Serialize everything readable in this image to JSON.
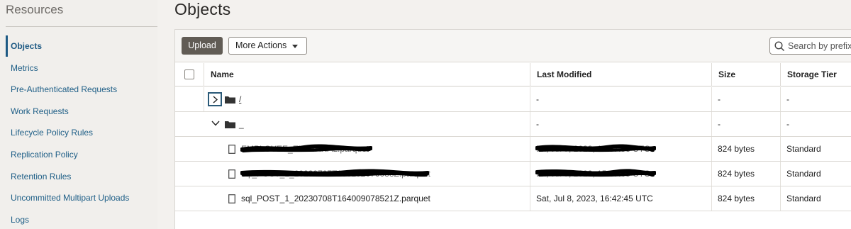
{
  "sidebar": {
    "title": "Resources",
    "items": [
      {
        "label": "Objects",
        "active": true
      },
      {
        "label": "Metrics"
      },
      {
        "label": "Pre-Authenticated Requests"
      },
      {
        "label": "Work Requests"
      },
      {
        "label": "Lifecycle Policy Rules"
      },
      {
        "label": "Replication Policy"
      },
      {
        "label": "Retention Rules"
      },
      {
        "label": "Uncommitted Multipart Uploads"
      },
      {
        "label": "Logs"
      }
    ]
  },
  "page": {
    "title": "Objects"
  },
  "toolbar": {
    "upload_label": "Upload",
    "more_actions_label": "More Actions",
    "search_placeholder": "Search by prefix"
  },
  "table": {
    "headers": {
      "name": "Name",
      "last_modified": "Last Modified",
      "size": "Size",
      "storage_tier": "Storage Tier"
    },
    "rows": [
      {
        "type": "folder",
        "expanded": false,
        "name": "/",
        "last_modified": "-",
        "size": "-",
        "storage_tier": "-"
      },
      {
        "type": "folder",
        "expanded": true,
        "name": "_",
        "last_modified": "-",
        "size": "-",
        "storage_tier": "-"
      },
      {
        "type": "file",
        "name": "EMPLOYEE_EXTERNAL.parquet",
        "last_modified": "Fri, Jul 7, 2023, 15:37:53 UTC",
        "size": "824 bytes",
        "storage_tier": "Standard",
        "redacted": true
      },
      {
        "type": "file",
        "name": "sql_POST_1_20230707T150192070033Z.parquet",
        "last_modified": "Fri, Jul 7, 2023, 15:37:05 UTC",
        "size": "824 bytes",
        "storage_tier": "Standard",
        "redacted": true
      },
      {
        "type": "file",
        "name": "sql_POST_1_20230708T164009078521Z.parquet",
        "last_modified": "Sat, Jul 8, 2023, 16:42:45 UTC",
        "size": "824 bytes",
        "storage_tier": "Standard",
        "redacted": false
      }
    ]
  },
  "colors": {
    "link": "#1f5f87",
    "upload_bg": "#615c55",
    "redaction": "#000000"
  }
}
